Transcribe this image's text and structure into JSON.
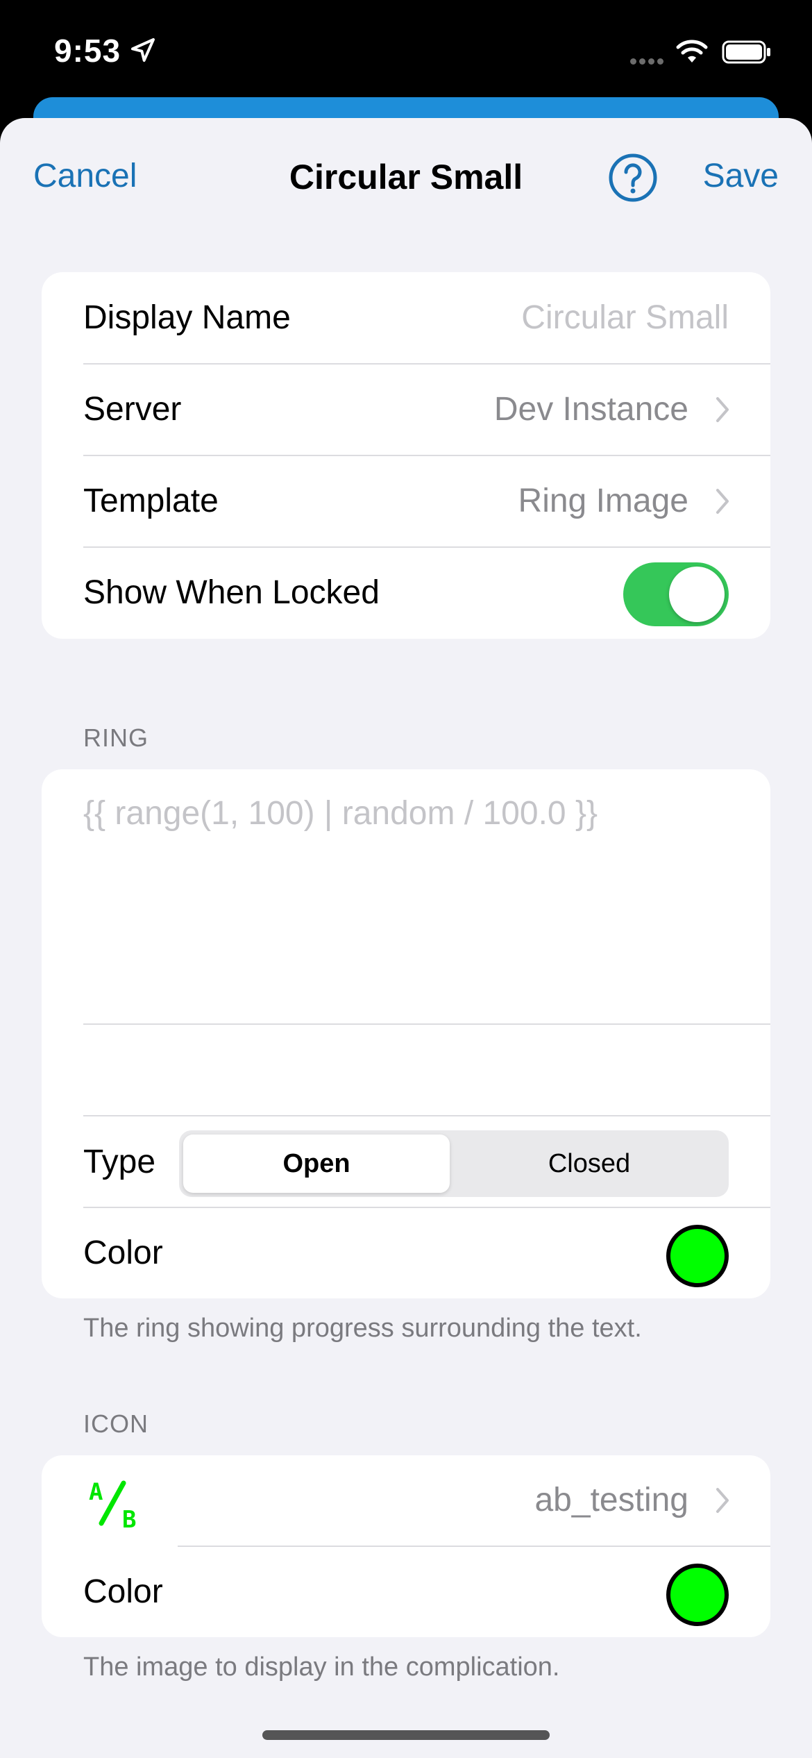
{
  "status_bar": {
    "time": "9:53"
  },
  "nav": {
    "cancel": "Cancel",
    "title": "Circular Small",
    "save": "Save"
  },
  "general": {
    "display_name_label": "Display Name",
    "display_name_placeholder": "Circular Small",
    "server_label": "Server",
    "server_value": "Dev Instance",
    "template_label": "Template",
    "template_value": "Ring Image",
    "show_when_locked_label": "Show When Locked",
    "show_when_locked": true
  },
  "ring": {
    "header": "RING",
    "template_text": "{{ range(1, 100) | random / 100.0 }}",
    "type_label": "Type",
    "type_options": [
      "Open",
      "Closed"
    ],
    "type_selected": "Open",
    "color_label": "Color",
    "color": "#00ff00",
    "footer": "The ring showing progress surrounding the text."
  },
  "icon": {
    "header": "ICON",
    "icon_name": "ab_testing",
    "icon_color": "#00ff00",
    "color_label": "Color",
    "footer": "The image to display in the complication."
  },
  "colors": {
    "accent": "#1a72b5",
    "toggle_on": "#35c759",
    "swatch_green": "#00ff00"
  }
}
